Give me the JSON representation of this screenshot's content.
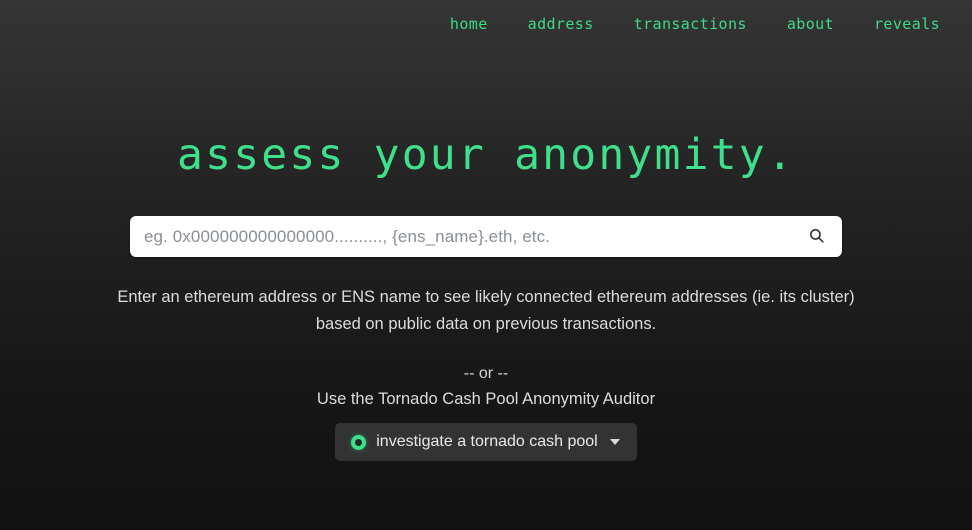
{
  "nav": {
    "items": [
      {
        "label": "home",
        "name": "nav-link-home"
      },
      {
        "label": "address",
        "name": "nav-link-address"
      },
      {
        "label": "transactions",
        "name": "nav-link-transactions"
      },
      {
        "label": "about",
        "name": "nav-link-about"
      },
      {
        "label": "reveals",
        "name": "nav-link-reveals"
      }
    ]
  },
  "hero": {
    "headline": "assess your anonymity."
  },
  "search": {
    "placeholder": "eg. 0x000000000000000.........., {ens_name}.eth, etc.",
    "value": "",
    "icon": "search-icon"
  },
  "description": {
    "text": "Enter an ethereum address or ENS name to see likely connected ethereum addresses (ie. its cluster) based on public data on previous transactions."
  },
  "alternative": {
    "separator": "-- or --",
    "label": "Use the Tornado Cash Pool Anonymity Auditor",
    "button_label": "investigate a tornado cash pool",
    "button_icon": "tornado-pool-icon",
    "caret_icon": "chevron-down-icon"
  },
  "colors": {
    "accent_green": "#3fe08c",
    "nav_green": "#3fd98a",
    "body_text": "#dcdcdc",
    "input_bg": "#ffffff",
    "button_bg": "#333333",
    "page_bg_top": "#343434",
    "page_bg_bottom": "#111111"
  }
}
